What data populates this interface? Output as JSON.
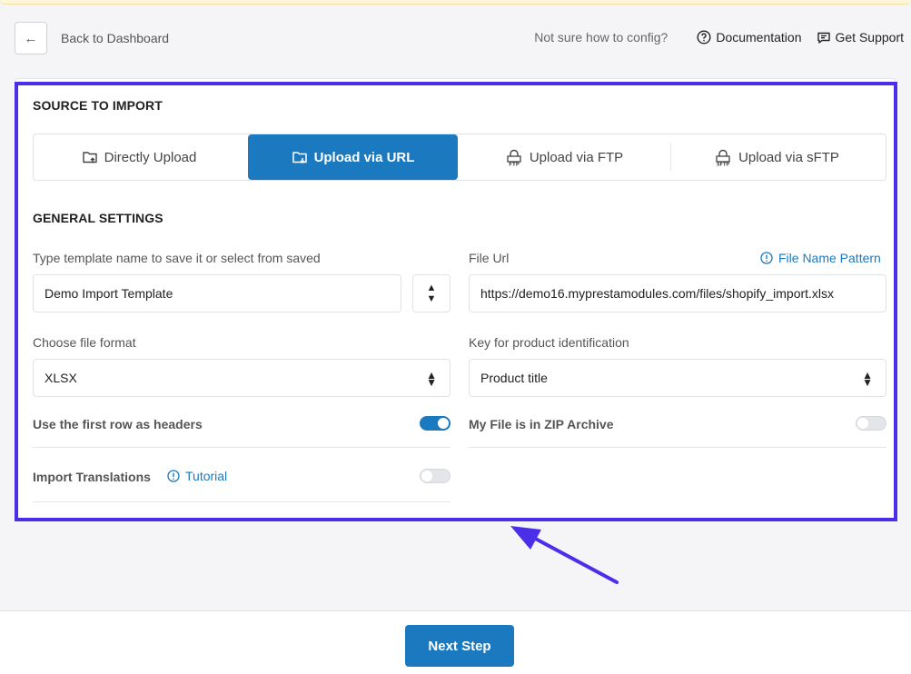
{
  "header": {
    "back_label": "Back to Dashboard",
    "help_question": "Not sure how to config?",
    "documentation": "Documentation",
    "support": "Get Support"
  },
  "source": {
    "title": "SOURCE TO IMPORT",
    "tabs": [
      {
        "label": "Directly Upload",
        "icon": "upload-file-icon"
      },
      {
        "label": "Upload via URL",
        "icon": "folder-link-icon",
        "active": true
      },
      {
        "label": "Upload via FTP",
        "icon": "ftp-lock-icon"
      },
      {
        "label": "Upload via sFTP",
        "icon": "sftp-lock-icon"
      }
    ]
  },
  "general": {
    "title": "GENERAL SETTINGS",
    "template_label": "Type template name to save it or select from saved",
    "template_value": "Demo Import Template",
    "file_url_label": "File Url",
    "file_name_pattern": "File Name Pattern",
    "file_url_value": "https://demo16.myprestamodules.com/files/shopify_import.xlsx",
    "format_label": "Choose file format",
    "format_value": "XLSX",
    "key_label": "Key for product identification",
    "key_value": "Product title",
    "first_row_label": "Use the first row as headers",
    "first_row_on": true,
    "zip_label": "My File is in ZIP Archive",
    "zip_on": false,
    "translations_label": "Import Translations",
    "tutorial": "Tutorial",
    "translations_on": false
  },
  "footer": {
    "next_label": "Next Step"
  },
  "colors": {
    "accent": "#1b7abf",
    "highlight": "#4a2ee8"
  }
}
